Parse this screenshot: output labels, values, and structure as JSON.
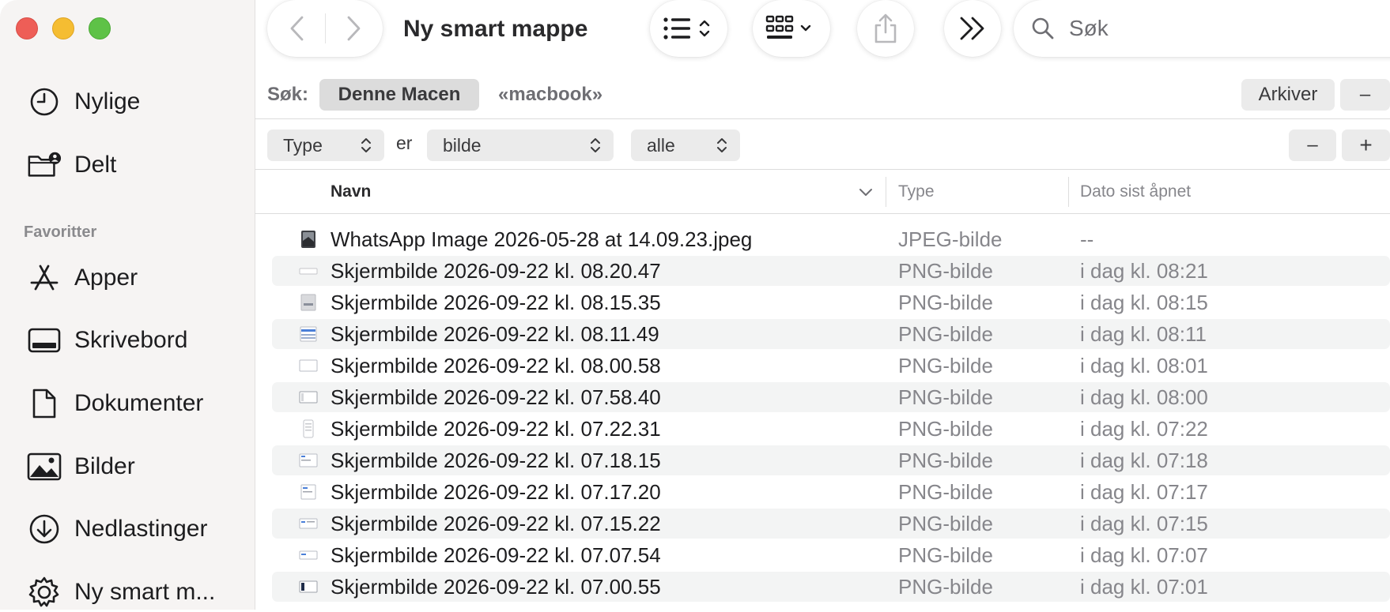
{
  "window": {
    "title": "Ny smart mappe"
  },
  "sidebar": {
    "top_items": [
      {
        "label": "Nylige",
        "icon": "clock-icon"
      },
      {
        "label": "Delt",
        "icon": "shared-folder-icon"
      }
    ],
    "section_title": "Favoritter",
    "favorites": [
      {
        "label": "Apper",
        "icon": "apps-icon"
      },
      {
        "label": "Skrivebord",
        "icon": "desktop-icon"
      },
      {
        "label": "Dokumenter",
        "icon": "document-icon"
      },
      {
        "label": "Bilder",
        "icon": "photo-icon"
      },
      {
        "label": "Nedlastinger",
        "icon": "download-icon"
      },
      {
        "label": "Ny smart m...",
        "icon": "gear-icon"
      }
    ]
  },
  "toolbar": {
    "search_placeholder": "Søk"
  },
  "scope_bar": {
    "label": "Søk:",
    "options": [
      "Denne Macen",
      "«macbook»"
    ],
    "selected": "Denne Macen",
    "save_label": "Arkiver",
    "remove_label": "–"
  },
  "criteria": {
    "attribute": "Type",
    "operator": "er",
    "value": "bilde",
    "qualifier": "alle",
    "remove_label": "–",
    "add_label": "+"
  },
  "table": {
    "columns": [
      "Navn",
      "Type",
      "Dato sist åpnet"
    ],
    "sort_column": "Navn",
    "rows": [
      {
        "name": "WhatsApp Image 2026-05-28 at 14.09.23.jpeg",
        "type": "JPEG-bilde",
        "date": "--"
      },
      {
        "name": "Skjermbilde 2026-09-22 kl. 08.20.47",
        "type": "PNG-bilde",
        "date": "i dag kl. 08:21"
      },
      {
        "name": "Skjermbilde 2026-09-22 kl. 08.15.35",
        "type": "PNG-bilde",
        "date": "i dag kl. 08:15"
      },
      {
        "name": "Skjermbilde 2026-09-22 kl. 08.11.49",
        "type": "PNG-bilde",
        "date": "i dag kl. 08:11"
      },
      {
        "name": "Skjermbilde 2026-09-22 kl. 08.00.58",
        "type": "PNG-bilde",
        "date": "i dag kl. 08:01"
      },
      {
        "name": "Skjermbilde 2026-09-22 kl. 07.58.40",
        "type": "PNG-bilde",
        "date": "i dag kl. 08:00"
      },
      {
        "name": "Skjermbilde 2026-09-22 kl. 07.22.31",
        "type": "PNG-bilde",
        "date": "i dag kl. 07:22"
      },
      {
        "name": "Skjermbilde 2026-09-22 kl. 07.18.15",
        "type": "PNG-bilde",
        "date": "i dag kl. 07:18"
      },
      {
        "name": "Skjermbilde 2026-09-22 kl. 07.17.20",
        "type": "PNG-bilde",
        "date": "i dag kl. 07:17"
      },
      {
        "name": "Skjermbilde 2026-09-22 kl. 07.15.22",
        "type": "PNG-bilde",
        "date": "i dag kl. 07:15"
      },
      {
        "name": "Skjermbilde 2026-09-22 kl. 07.07.54",
        "type": "PNG-bilde",
        "date": "i dag kl. 07:07"
      },
      {
        "name": "Skjermbilde 2026-09-22 kl. 07.00.55",
        "type": "PNG-bilde",
        "date": "i dag kl. 07:01"
      }
    ]
  },
  "colors": {
    "close": "#ee5e57",
    "minimize": "#f5bd32",
    "zoom": "#5ec247",
    "sidebar_bg": "#f6f4f3",
    "row_alt": "#f3f4f4"
  }
}
